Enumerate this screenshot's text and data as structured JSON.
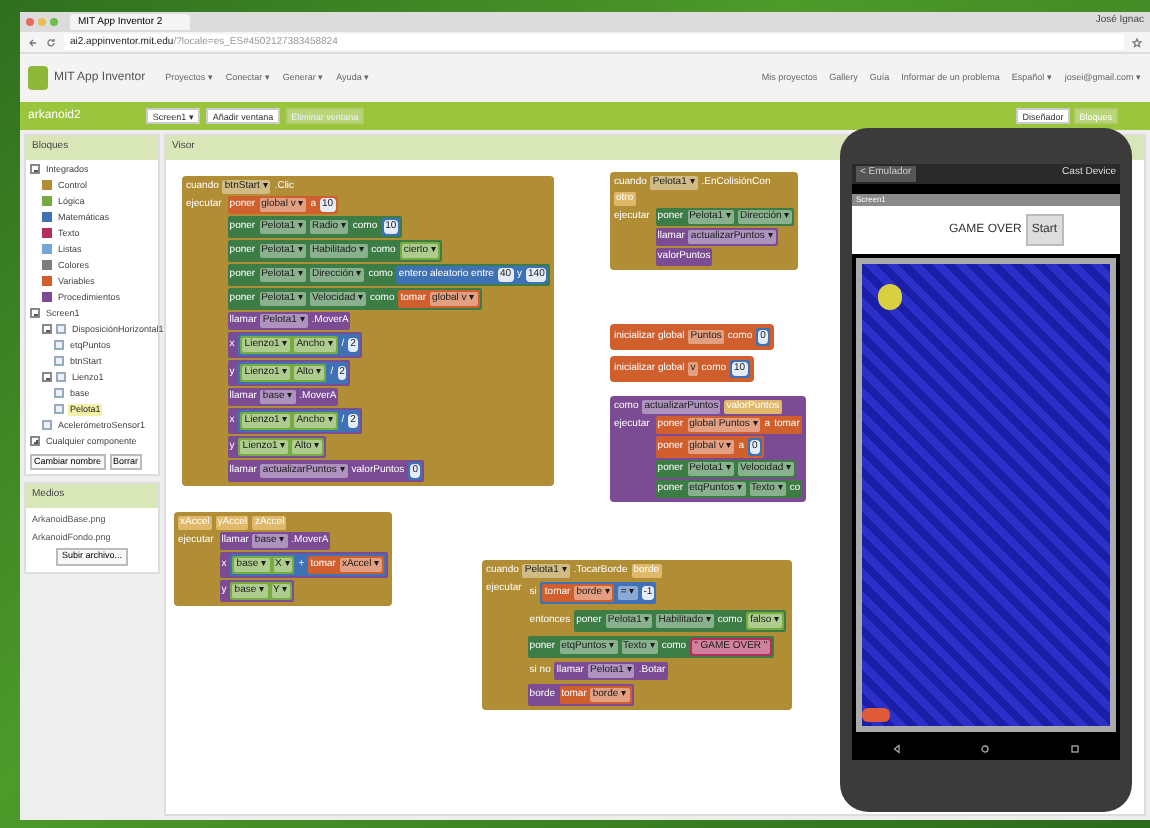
{
  "browser": {
    "tab_title": "MIT App Inventor 2",
    "url_host": "ai2.appinventor.mit.edu",
    "url_path": "/?locale=es_ES#4502127383458824",
    "user": "José Ignac"
  },
  "header": {
    "logo": "MIT App Inventor",
    "menus": [
      "Proyectos ▾",
      "Conectar ▾",
      "Generar ▾",
      "Ayuda ▾"
    ],
    "links": [
      "Mis proyectos",
      "Gallery",
      "Guía",
      "Informar de un problema",
      "Español ▾",
      "josei@gmail.com ▾"
    ]
  },
  "project_bar": {
    "name": "arkanoid2",
    "buttons": [
      {
        "label": "Screen1 ▾",
        "disabled": false
      },
      {
        "label": "Añadir ventana",
        "disabled": false
      },
      {
        "label": "Eliminar ventana",
        "disabled": true
      }
    ],
    "views": [
      {
        "label": "Diseñador",
        "selected": true
      },
      {
        "label": "Bloques",
        "selected": false
      }
    ]
  },
  "blocks_panel": {
    "title": "Bloques",
    "tree": [
      {
        "label": "Integrados",
        "expanded": true,
        "selected": false,
        "children": [
          {
            "label": "Control",
            "color": "#b18e35",
            "selected": false
          },
          {
            "label": "Lógica",
            "color": "#77ab41",
            "selected": false
          },
          {
            "label": "Matemáticas",
            "color": "#3f71b5",
            "selected": false
          },
          {
            "label": "Texto",
            "color": "#b32d5e",
            "selected": false
          },
          {
            "label": "Listas",
            "color": "#74a7d6",
            "selected": false
          },
          {
            "label": "Colores",
            "color": "#7d7d7d",
            "selected": false
          },
          {
            "label": "Variables",
            "color": "#d05f2d",
            "selected": false
          },
          {
            "label": "Procedimientos",
            "color": "#7b4b94",
            "selected": false
          }
        ]
      },
      {
        "label": "Screen1",
        "expanded": true,
        "selected": false,
        "children": [
          {
            "label": "DisposiciónHorizontal1",
            "expanded": true,
            "selected": false,
            "children": [
              {
                "label": "etqPuntos",
                "selected": false
              },
              {
                "label": "btnStart",
                "selected": false
              }
            ]
          },
          {
            "label": "Lienzo1",
            "expanded": true,
            "selected": false,
            "children": [
              {
                "label": "base",
                "selected": false
              },
              {
                "label": "Pelota1",
                "selected": true
              }
            ]
          },
          {
            "label": "AcelerómetroSensor1",
            "selected": false
          }
        ]
      },
      {
        "label": "Cualquier componente",
        "expanded": false,
        "selected": false
      }
    ],
    "buttons": [
      "Cambiar nombre",
      "Borrar"
    ]
  },
  "media_panel": {
    "title": "Medios",
    "files": [
      "ArkanoidBase.png",
      "ArkanoidFondo.png"
    ],
    "upload_button": "Subir archivo..."
  },
  "viewer": {
    "title": "Visor",
    "blocks": [
      {
        "kind": "event",
        "header": [
          {
            "kind": "label",
            "t": "cuando"
          },
          {
            "kind": "field",
            "t": "btnStart ▾"
          },
          {
            "kind": "label",
            "t": ".Clic"
          }
        ],
        "label": "ejecutar",
        "body": [
          {
            "kind": "var",
            "tokens": [
              {
                "kind": "label",
                "t": "poner"
              },
              {
                "kind": "field",
                "t": "global v ▾"
              },
              {
                "kind": "label",
                "t": "a"
              },
              {
                "kind": "num",
                "t": "10"
              }
            ]
          },
          {
            "kind": "set",
            "tokens": [
              {
                "kind": "label",
                "t": "poner"
              },
              {
                "kind": "field",
                "t": "Pelota1 ▾"
              },
              {
                "kind": "field",
                "t": "Radio ▾"
              },
              {
                "kind": "label",
                "t": "como"
              },
              {
                "kind": "math",
                "tokens": [
                  {
                    "kind": "num",
                    "t": "10"
                  }
                ]
              }
            ]
          },
          {
            "kind": "set",
            "tokens": [
              {
                "kind": "label",
                "t": "poner"
              },
              {
                "kind": "field",
                "t": "Pelota1 ▾"
              },
              {
                "kind": "field",
                "t": "Habilitado ▾"
              },
              {
                "kind": "label",
                "t": "como"
              },
              {
                "kind": "logic",
                "tokens": [
                  {
                    "kind": "field",
                    "t": "cierto ▾"
                  }
                ]
              }
            ]
          },
          {
            "kind": "set",
            "tokens": [
              {
                "kind": "label",
                "t": "poner"
              },
              {
                "kind": "field",
                "t": "Pelota1 ▾"
              },
              {
                "kind": "field",
                "t": "Dirección ▾"
              },
              {
                "kind": "label",
                "t": "como"
              },
              {
                "kind": "math",
                "tokens": [
                  {
                    "kind": "label",
                    "t": "entero aleatorio entre"
                  },
                  {
                    "kind": "num",
                    "t": "40"
                  },
                  {
                    "kind": "label",
                    "t": "y"
                  },
                  {
                    "kind": "num",
                    "t": "140"
                  }
                ]
              }
            ]
          },
          {
            "kind": "set",
            "tokens": [
              {
                "kind": "label",
                "t": "poner"
              },
              {
                "kind": "field",
                "t": "Pelota1 ▾"
              },
              {
                "kind": "field",
                "t": "Velocidad ▾"
              },
              {
                "kind": "label",
                "t": "como"
              },
              {
                "kind": "var",
                "tokens": [
                  {
                    "kind": "label",
                    "t": "tomar"
                  },
                  {
                    "kind": "field",
                    "t": "global v ▾"
                  }
                ]
              }
            ]
          },
          {
            "kind": "call",
            "tokens": [
              {
                "kind": "label",
                "t": "llamar"
              },
              {
                "kind": "field",
                "t": "Pelota1 ▾"
              },
              {
                "kind": "label",
                "t": ".MoverA"
              }
            ]
          },
          {
            "kind": "call",
            "tokens": [
              {
                "kind": "label",
                "t": "x"
              },
              {
                "kind": "math",
                "tokens": [
                  {
                    "kind": "logic",
                    "tokens": [
                      {
                        "kind": "field",
                        "t": "Lienzo1 ▾"
                      },
                      {
                        "kind": "field",
                        "t": "Ancho ▾"
                      }
                    ]
                  },
                  {
                    "kind": "label",
                    "t": "/"
                  },
                  {
                    "kind": "num",
                    "t": "2"
                  }
                ]
              }
            ]
          },
          {
            "kind": "call",
            "tokens": [
              {
                "kind": "label",
                "t": "y"
              },
              {
                "kind": "math",
                "tokens": [
                  {
                    "kind": "logic",
                    "tokens": [
                      {
                        "kind": "field",
                        "t": "Lienzo1 ▾"
                      },
                      {
                        "kind": "field",
                        "t": "Alto ▾"
                      }
                    ]
                  },
                  {
                    "kind": "label",
                    "t": "/"
                  },
                  {
                    "kind": "num",
                    "t": "2"
                  }
                ]
              }
            ]
          },
          {
            "kind": "call",
            "tokens": [
              {
                "kind": "label",
                "t": "llamar"
              },
              {
                "kind": "field",
                "t": "base ▾"
              },
              {
                "kind": "label",
                "t": ".MoverA"
              }
            ]
          },
          {
            "kind": "call",
            "tokens": [
              {
                "kind": "label",
                "t": "x"
              },
              {
                "kind": "math",
                "tokens": [
                  {
                    "kind": "logic",
                    "tokens": [
                      {
                        "kind": "field",
                        "t": "Lienzo1 ▾"
                      },
                      {
                        "kind": "field",
                        "t": "Ancho ▾"
                      }
                    ]
                  },
                  {
                    "kind": "label",
                    "t": "/"
                  },
                  {
                    "kind": "num",
                    "t": "2"
                  }
                ]
              }
            ]
          },
          {
            "kind": "call",
            "tokens": [
              {
                "kind": "label",
                "t": "y"
              },
              {
                "kind": "logic",
                "tokens": [
                  {
                    "kind": "field",
                    "t": "Lienzo1 ▾"
                  },
                  {
                    "kind": "field",
                    "t": "Alto ▾"
                  }
                ]
              }
            ]
          },
          {
            "kind": "call",
            "tokens": [
              {
                "kind": "label",
                "t": "llamar"
              },
              {
                "kind": "field",
                "t": "actualizarPuntos ▾"
              },
              {
                "kind": "label",
                "t": "valorPuntos"
              },
              {
                "kind": "math",
                "tokens": [
                  {
                    "kind": "num",
                    "t": "0"
                  }
                ]
              }
            ]
          }
        ]
      },
      {
        "kind": "event",
        "header": [
          {
            "kind": "param",
            "t": "xAccel"
          },
          {
            "kind": "param",
            "t": "yAccel"
          },
          {
            "kind": "param",
            "t": "zAccel"
          }
        ],
        "label": "ejecutar",
        "body": [
          {
            "kind": "call",
            "tokens": [
              {
                "kind": "label",
                "t": "llamar"
              },
              {
                "kind": "field",
                "t": "base ▾"
              },
              {
                "kind": "label",
                "t": ".MoverA"
              }
            ]
          },
          {
            "kind": "call",
            "tokens": [
              {
                "kind": "label",
                "t": "x"
              },
              {
                "kind": "math",
                "tokens": [
                  {
                    "kind": "logic",
                    "tokens": [
                      {
                        "kind": "field",
                        "t": "base ▾"
                      },
                      {
                        "kind": "field",
                        "t": "X ▾"
                      }
                    ]
                  },
                  {
                    "kind": "label",
                    "t": "+"
                  },
                  {
                    "kind": "var",
                    "tokens": [
                      {
                        "kind": "label",
                        "t": "tomar"
                      },
                      {
                        "kind": "field",
                        "t": "xAccel ▾"
                      }
                    ]
                  }
                ]
              }
            ]
          },
          {
            "kind": "call",
            "tokens": [
              {
                "kind": "label",
                "t": "y"
              },
              {
                "kind": "logic",
                "tokens": [
                  {
                    "kind": "field",
                    "t": "base ▾"
                  },
                  {
                    "kind": "field",
                    "t": "Y ▾"
                  }
                ]
              }
            ]
          }
        ]
      },
      {
        "kind": "event",
        "header": [
          {
            "kind": "label",
            "t": "cuando"
          },
          {
            "kind": "field",
            "t": "Pelota1 ▾"
          },
          {
            "kind": "label",
            "t": ".EnColisiónCon"
          }
        ],
        "params": [
          "otro"
        ],
        "label": "ejecutar",
        "body": [
          {
            "kind": "set",
            "tokens": [
              {
                "kind": "label",
                "t": "poner"
              },
              {
                "kind": "field",
                "t": "Pelota1 ▾"
              },
              {
                "kind": "field",
                "t": "Dirección ▾"
              }
            ]
          },
          {
            "kind": "call",
            "tokens": [
              {
                "kind": "label",
                "t": "llamar"
              },
              {
                "kind": "field",
                "t": "actualizarPuntos ▾"
              }
            ]
          },
          {
            "kind": "call",
            "tokens": [
              {
                "kind": "label",
                "t": "valorPuntos"
              }
            ]
          }
        ]
      },
      {
        "kind": "var",
        "header": [
          {
            "kind": "label",
            "t": "inicializar global"
          },
          {
            "kind": "field",
            "t": "Puntos"
          },
          {
            "kind": "label",
            "t": "como"
          },
          {
            "kind": "math",
            "tokens": [
              {
                "kind": "num",
                "t": "0"
              }
            ]
          }
        ]
      },
      {
        "kind": "var",
        "header": [
          {
            "kind": "label",
            "t": "inicializar global"
          },
          {
            "kind": "field",
            "t": "v"
          },
          {
            "kind": "label",
            "t": "como"
          },
          {
            "kind": "math",
            "tokens": [
              {
                "kind": "num",
                "t": "10"
              }
            ]
          }
        ]
      },
      {
        "kind": "proc",
        "header": [
          {
            "kind": "label",
            "t": "como"
          },
          {
            "kind": "field",
            "t": "actualizarPuntos"
          },
          {
            "kind": "param",
            "t": "valorPuntos"
          }
        ],
        "label": "ejecutar",
        "body": [
          {
            "kind": "var",
            "tokens": [
              {
                "kind": "label",
                "t": "poner"
              },
              {
                "kind": "field",
                "t": "global Puntos ▾"
              },
              {
                "kind": "label",
                "t": "a"
              },
              {
                "kind": "label",
                "t": "tomar"
              }
            ]
          },
          {
            "kind": "var",
            "tokens": [
              {
                "kind": "label",
                "t": "poner"
              },
              {
                "kind": "field",
                "t": "global v ▾"
              },
              {
                "kind": "label",
                "t": "a"
              },
              {
                "kind": "math",
                "tokens": [
                  {
                    "kind": "num",
                    "t": "0"
                  }
                ]
              }
            ]
          },
          {
            "kind": "set",
            "tokens": [
              {
                "kind": "label",
                "t": "poner"
              },
              {
                "kind": "field",
                "t": "Pelota1 ▾"
              },
              {
                "kind": "field",
                "t": "Velocidad ▾"
              }
            ]
          },
          {
            "kind": "set",
            "tokens": [
              {
                "kind": "label",
                "t": "poner"
              },
              {
                "kind": "field",
                "t": "etqPuntos ▾"
              },
              {
                "kind": "field",
                "t": "Texto ▾"
              },
              {
                "kind": "label",
                "t": "co"
              }
            ]
          }
        ]
      },
      {
        "kind": "event",
        "header": [
          {
            "kind": "label",
            "t": "cuando"
          },
          {
            "kind": "field",
            "t": "Pelota1 ▾"
          },
          {
            "kind": "label",
            "t": ".TocarBorde"
          },
          {
            "kind": "param",
            "t": "borde"
          }
        ],
        "label": "ejecutar",
        "body": [
          {
            "kind": "event",
            "tokens": [
              {
                "kind": "label",
                "t": "si"
              },
              {
                "kind": "math",
                "tokens": [
                  {
                    "kind": "var",
                    "tokens": [
                      {
                        "kind": "label",
                        "t": "tomar"
                      },
                      {
                        "kind": "field",
                        "t": "borde ▾"
                      }
                    ]
                  },
                  {
                    "kind": "field",
                    "t": "= ▾"
                  },
                  {
                    "kind": "num",
                    "t": "-1"
                  }
                ]
              }
            ]
          },
          {
            "kind": "event",
            "tokens": [
              {
                "kind": "label",
                "t": "entonces"
              },
              {
                "kind": "set",
                "tokens": [
                  {
                    "kind": "label",
                    "t": "poner"
                  },
                  {
                    "kind": "field",
                    "t": "Pelota1 ▾"
                  },
                  {
                    "kind": "field",
                    "t": "Habilitado ▾"
                  },
                  {
                    "kind": "label",
                    "t": "como"
                  },
                  {
                    "kind": "logic",
                    "tokens": [
                      {
                        "kind": "field",
                        "t": "falso ▾"
                      }
                    ]
                  }
                ]
              }
            ]
          },
          {
            "kind": "set",
            "tokens": [
              {
                "kind": "label",
                "t": "poner"
              },
              {
                "kind": "field",
                "t": "etqPuntos ▾"
              },
              {
                "kind": "field",
                "t": "Texto ▾"
              },
              {
                "kind": "label",
                "t": "como"
              },
              {
                "kind": "text",
                "tokens": [
                  {
                    "kind": "field",
                    "t": "\" GAME OVER \""
                  }
                ]
              }
            ]
          },
          {
            "kind": "event",
            "tokens": [
              {
                "kind": "label",
                "t": "si no"
              },
              {
                "kind": "call",
                "tokens": [
                  {
                    "kind": "label",
                    "t": "llamar"
                  },
                  {
                    "kind": "field",
                    "t": "Pelota1 ▾"
                  },
                  {
                    "kind": "label",
                    "t": ".Botar"
                  }
                ]
              }
            ]
          },
          {
            "kind": "call",
            "tokens": [
              {
                "kind": "label",
                "t": "borde"
              },
              {
                "kind": "var",
                "tokens": [
                  {
                    "kind": "label",
                    "t": "tomar"
                  },
                  {
                    "kind": "field",
                    "t": "borde ▾"
                  }
                ]
              }
            ]
          }
        ]
      }
    ]
  },
  "emulator": {
    "back_label": "< Emulador",
    "cast_label": "Cast Device",
    "app_title": "Screen1",
    "score_label": "GAME OVER",
    "start_button": "Start"
  }
}
